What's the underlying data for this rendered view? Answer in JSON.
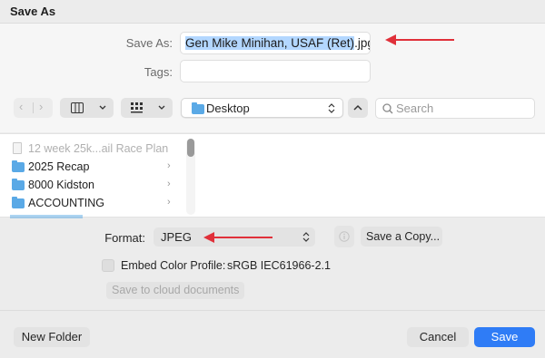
{
  "dialog": {
    "title": "Save As"
  },
  "save_as": {
    "label": "Save As:",
    "filename_selected": "Gen Mike Minihan, USAF (Ret)",
    "filename_ext": ".jpg"
  },
  "tags": {
    "label": "Tags:",
    "value": ""
  },
  "toolbar": {
    "location": "Desktop",
    "search_placeholder": "Search"
  },
  "files": [
    {
      "name": "12 week 25k...ail Race Plan",
      "kind": "document",
      "dimmed": true
    },
    {
      "name": "2025 Recap",
      "kind": "folder"
    },
    {
      "name": "8000 Kidston",
      "kind": "folder"
    },
    {
      "name": "ACCOUNTING",
      "kind": "folder"
    }
  ],
  "options": {
    "format_label": "Format:",
    "format_value": "JPEG",
    "save_copy_label": "Save a Copy...",
    "embed_label": "Embed Color Profile:",
    "embed_value": "sRGB IEC61966-2.1",
    "cloud_label": "Save to cloud documents"
  },
  "buttons": {
    "new_folder": "New Folder",
    "cancel": "Cancel",
    "save": "Save"
  },
  "colors": {
    "accent": "#2f7cf6",
    "selection": "#b3d7ff",
    "annotation_arrow": "#e0303a",
    "folder": "#5aa9e6"
  },
  "icons": [
    "back-arrow-icon",
    "forward-arrow-icon",
    "column-view-icon",
    "grid-view-icon",
    "chevron-down-icon",
    "folder-icon",
    "chevron-up-icon",
    "search-icon",
    "info-icon",
    "checkbox-icon",
    "chevron-right-icon",
    "document-icon"
  ]
}
